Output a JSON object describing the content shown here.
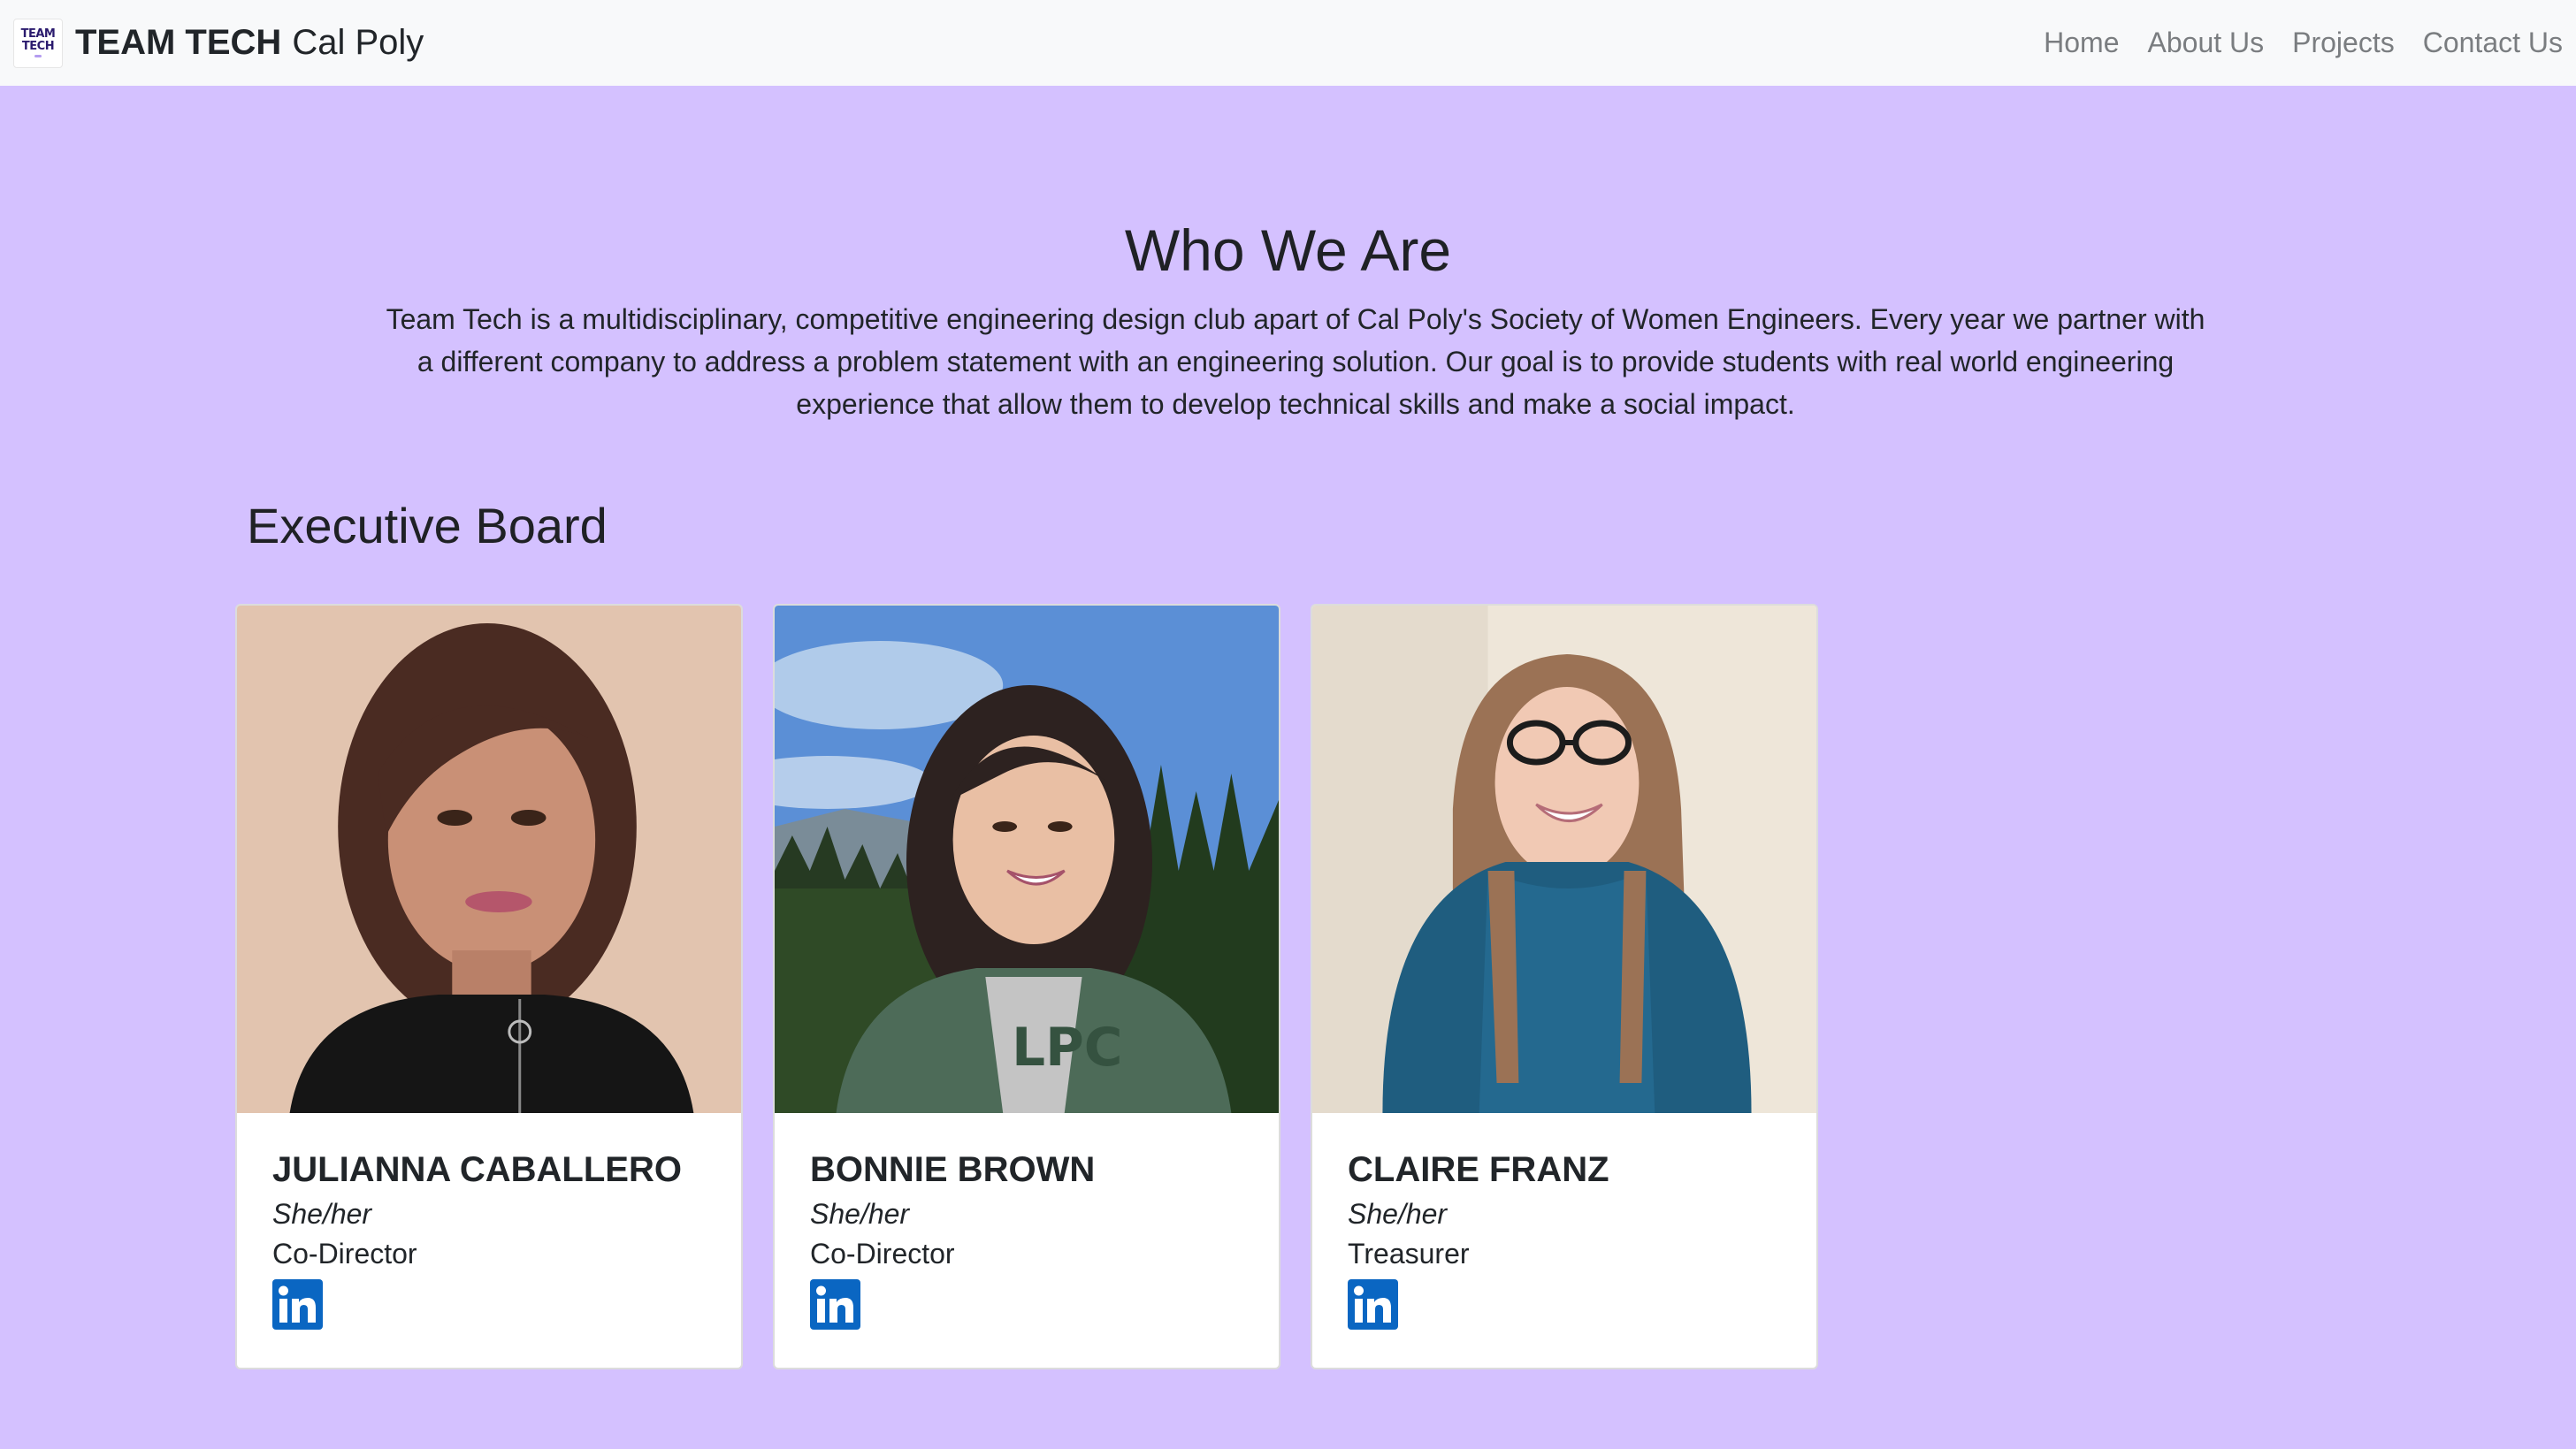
{
  "navbar": {
    "logo_line1": "TEAM",
    "logo_line2": "TECH",
    "brand_bold": "TEAM TECH",
    "brand_light": "Cal Poly",
    "links": [
      "Home",
      "About Us",
      "Projects",
      "Contact Us"
    ]
  },
  "intro": {
    "title": "Who We Are",
    "text": "Team Tech is a multidisciplinary, competitive engineering design club apart of Cal Poly's Society of Women Engineers. Every year we partner with a different company to address a problem statement with an engineering solution. Our goal is to provide students with real world engineering experience that allow them to develop technical skills and make a social impact."
  },
  "executive_board": {
    "title": "Executive Board",
    "members": [
      {
        "name": "JULIANNA CABALLERO",
        "pronouns": "She/her",
        "role": "Co-Director",
        "icon": "linkedin-icon"
      },
      {
        "name": "BONNIE BROWN",
        "pronouns": "She/her",
        "role": "Co-Director",
        "icon": "linkedin-icon"
      },
      {
        "name": "CLAIRE FRANZ",
        "pronouns": "She/her",
        "role": "Treasurer",
        "icon": "linkedin-icon"
      }
    ]
  },
  "colors": {
    "page_background": "#d4c1ff",
    "navbar_background": "#f8f9fa",
    "linkedin_blue": "#0a66c2"
  }
}
